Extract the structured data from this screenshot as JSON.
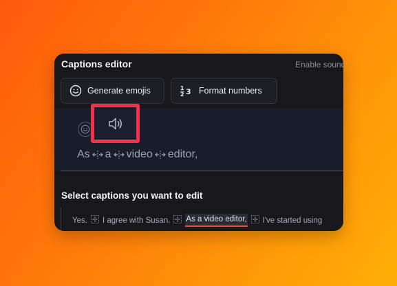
{
  "panel": {
    "title": "Captions editor",
    "enable_label": "Enable sound",
    "buttons": {
      "generate_emojis": "Generate emojis",
      "format_numbers": "Format numbers",
      "format_icon_text": "1⁄2 3"
    }
  },
  "editor": {
    "words": [
      "As",
      "a",
      "video",
      "editor,"
    ]
  },
  "section": {
    "title": "Select captions you want to edit"
  },
  "captions": [
    {
      "text": "Yes.",
      "selected": false
    },
    {
      "text": "I agree with Susan.",
      "selected": false
    },
    {
      "text": "As a video editor,",
      "selected": true
    },
    {
      "text": "I've started using",
      "selected": false
    }
  ],
  "colors": {
    "highlight": "#f5304a",
    "selected_underline": "#f0524a",
    "panel_bg": "#17171c"
  }
}
